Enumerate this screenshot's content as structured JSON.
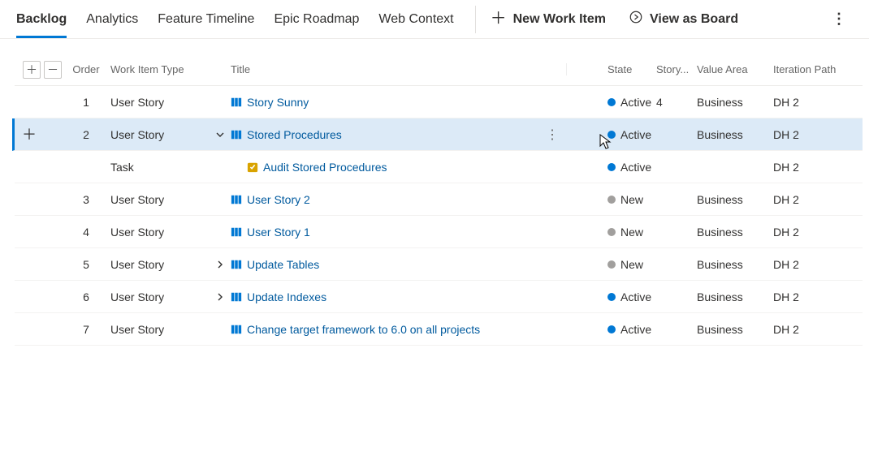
{
  "tabs": {
    "backlog": "Backlog",
    "analytics": "Analytics",
    "feature_timeline": "Feature Timeline",
    "epic_roadmap": "Epic Roadmap",
    "web_context": "Web Context"
  },
  "actions": {
    "new_item": "New Work Item",
    "view_board": "View as Board"
  },
  "columns": {
    "order": "Order",
    "type": "Work Item Type",
    "title": "Title",
    "state": "State",
    "story": "Story...",
    "value": "Value Area",
    "iter": "Iteration Path"
  },
  "rows": [
    {
      "order": "1",
      "type": "User Story",
      "icon": "userstory",
      "indent": 0,
      "chev": "",
      "title": "Story Sunny",
      "state": "Active",
      "story": "4",
      "value": "Business",
      "iter": "DH 2"
    },
    {
      "order": "2",
      "type": "User Story",
      "icon": "userstory",
      "indent": 0,
      "chev": "down",
      "title": "Stored Procedures",
      "state": "Active",
      "story": "",
      "value": "Business",
      "iter": "DH 2",
      "selected": true,
      "more": true
    },
    {
      "order": "",
      "type": "Task",
      "icon": "task",
      "indent": 1,
      "chev": "",
      "title": "Audit Stored Procedures",
      "state": "Active",
      "story": "",
      "value": "",
      "iter": "DH 2"
    },
    {
      "order": "3",
      "type": "User Story",
      "icon": "userstory",
      "indent": 0,
      "chev": "",
      "title": "User Story 2",
      "state": "New",
      "story": "",
      "value": "Business",
      "iter": "DH 2"
    },
    {
      "order": "4",
      "type": "User Story",
      "icon": "userstory",
      "indent": 0,
      "chev": "",
      "title": "User Story 1",
      "state": "New",
      "story": "",
      "value": "Business",
      "iter": "DH 2"
    },
    {
      "order": "5",
      "type": "User Story",
      "icon": "userstory",
      "indent": 0,
      "chev": "right",
      "title": "Update Tables",
      "state": "New",
      "story": "",
      "value": "Business",
      "iter": "DH 2"
    },
    {
      "order": "6",
      "type": "User Story",
      "icon": "userstory",
      "indent": 0,
      "chev": "right",
      "title": "Update Indexes",
      "state": "Active",
      "story": "",
      "value": "Business",
      "iter": "DH 2"
    },
    {
      "order": "7",
      "type": "User Story",
      "icon": "userstory",
      "indent": 0,
      "chev": "",
      "title": "Change target framework to 6.0 on all projects",
      "state": "Active",
      "story": "",
      "value": "Business",
      "iter": "DH 2"
    }
  ]
}
